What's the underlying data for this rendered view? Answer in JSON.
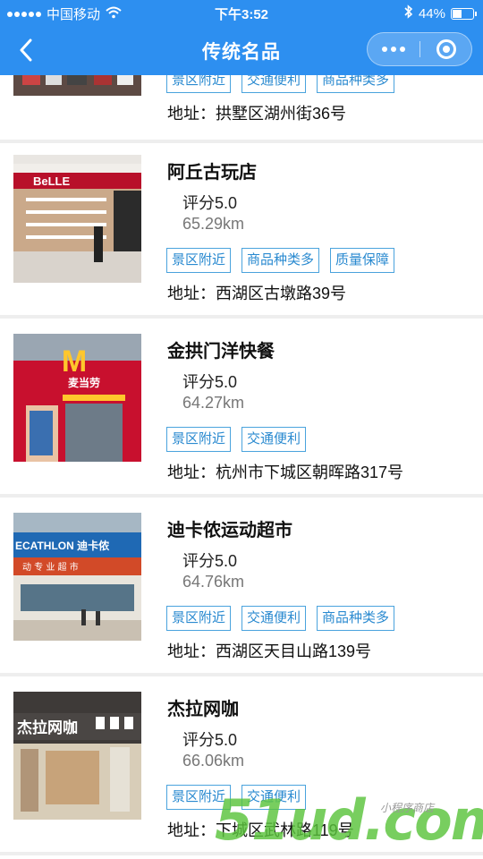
{
  "status_bar": {
    "carrier": "中国移动",
    "time": "下午3:52",
    "battery": "44%",
    "battery_level": 0.44
  },
  "nav": {
    "title": "传统名品",
    "icons": [
      "back-icon",
      "more-dots-icon",
      "close-ring-icon"
    ]
  },
  "list": [
    {
      "name": "",
      "score": "",
      "distance": "",
      "tags": [
        "景区附近",
        "交通便利",
        "商品种类多"
      ],
      "address": "地址：拱墅区湖州街36号"
    },
    {
      "name": "阿丘古玩店",
      "score": "评分5.0",
      "distance": "65.29km",
      "tags": [
        "景区附近",
        "商品种类多",
        "质量保障"
      ],
      "address": "地址：西湖区古墩路39号",
      "sign": "BeLLE"
    },
    {
      "name": "金拱门洋快餐",
      "score": "评分5.0",
      "distance": "64.27km",
      "tags": [
        "景区附近",
        "交通便利"
      ],
      "address": "地址：杭州市下城区朝晖路317号",
      "sign": "麦当劳"
    },
    {
      "name": "迪卡侬运动超市",
      "score": "评分5.0",
      "distance": "64.76km",
      "tags": [
        "景区附近",
        "交通便利",
        "商品种类多"
      ],
      "address": "地址：西湖区天目山路139号",
      "sign": "ECATHLON 迪卡侬",
      "sign2": "动 专 业 超 市"
    },
    {
      "name": "杰拉网咖",
      "score": "评分5.0",
      "distance": "66.06km",
      "tags": [
        "景区附近",
        "交通便利"
      ],
      "address": "地址：下城区武林路119号",
      "sign": "杰拉网咖"
    }
  ],
  "watermark": {
    "text": "51ud.com",
    "small": "小程序商店"
  }
}
